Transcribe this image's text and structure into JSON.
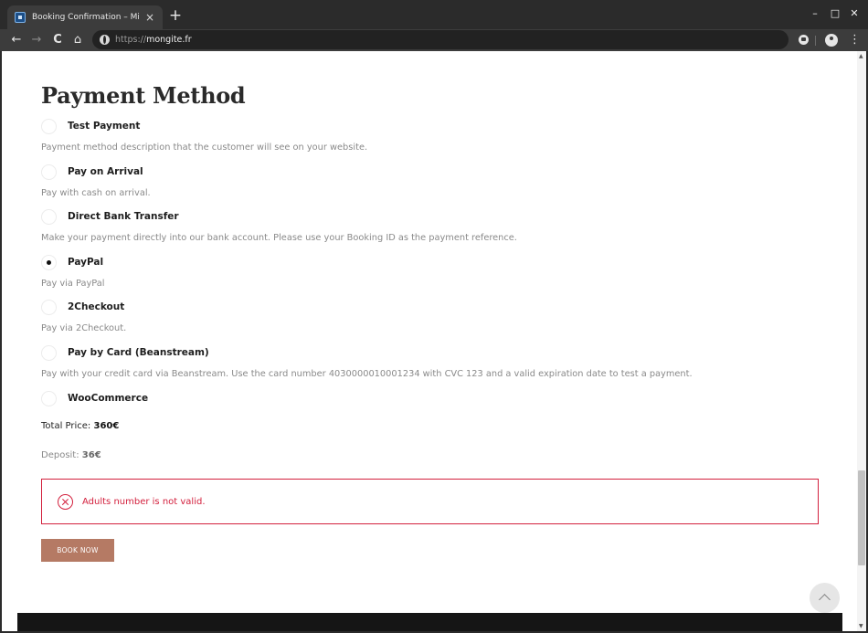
{
  "browser": {
    "tab_title": "Booking Confirmation – Milenia",
    "tab_close": "×",
    "new_tab": "+",
    "window_controls": {
      "minimize": "–",
      "maximize": "□",
      "close": "✕"
    },
    "nav": {
      "back": "←",
      "forward": "→",
      "reload": "C",
      "home": "⌂",
      "menu": "⋮"
    },
    "url_scheme": "https://",
    "url_host": "mongite.fr"
  },
  "page": {
    "title": "Payment Method",
    "payment_options": [
      {
        "label": "Test Payment",
        "selected": false,
        "description": "Payment method description that the customer will see on your website."
      },
      {
        "label": "Pay on Arrival",
        "selected": false,
        "description": "Pay with cash on arrival."
      },
      {
        "label": "Direct Bank Transfer",
        "selected": false,
        "description": "Make your payment directly into our bank account. Please use your Booking ID as the payment reference."
      },
      {
        "label": "PayPal",
        "selected": true,
        "description": "Pay via PayPal"
      },
      {
        "label": "2Checkout",
        "selected": false,
        "description": "Pay via 2Checkout."
      },
      {
        "label": "Pay by Card (Beanstream)",
        "selected": false,
        "description": "Pay with your credit card via Beanstream. Use the card number 4030000010001234 with CVC 123 and a valid expiration date to test a payment."
      },
      {
        "label": "WooCommerce",
        "selected": false,
        "description": ""
      }
    ],
    "total_label": "Total Price:",
    "total_value": "360€",
    "deposit_label": "Deposit:",
    "deposit_value": "36€",
    "error_message": "Adults number is not valid.",
    "book_button": "BOOK NOW"
  },
  "colors": {
    "accent": "#b57a64",
    "error": "#d3203d",
    "footer": "#151515"
  }
}
